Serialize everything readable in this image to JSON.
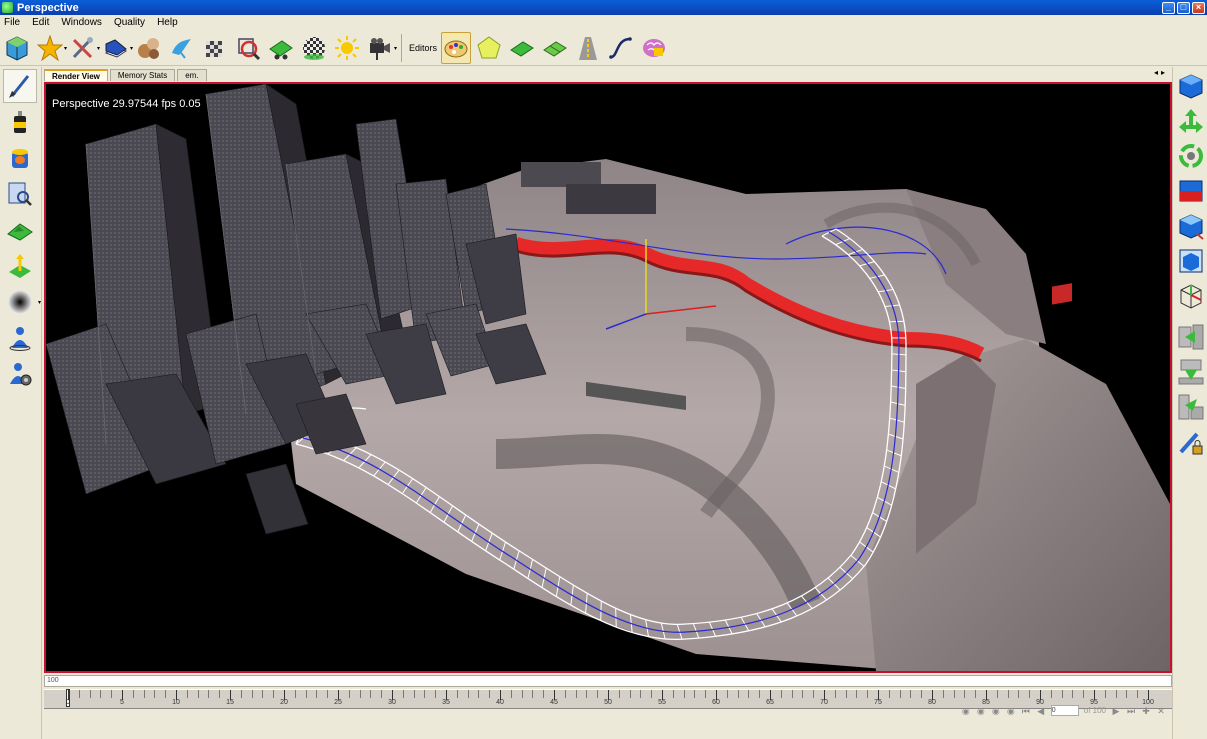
{
  "window": {
    "title": "Perspective"
  },
  "menu": [
    "File",
    "Edit",
    "Windows",
    "Quality",
    "Help"
  ],
  "toolbar": {
    "editors_label": "Editors"
  },
  "tabs": [
    {
      "label": "Render View",
      "active": true
    },
    {
      "label": "Memory Stats",
      "active": false
    },
    {
      "label": "em.",
      "active": false
    }
  ],
  "viewport": {
    "overlay_text": "Perspective 29.97544 fps 0.05"
  },
  "timeline": {
    "top_value": "100",
    "current_frame": 0,
    "max_frame": 100,
    "ticks": [
      "0",
      "5",
      "10",
      "15",
      "20",
      "25",
      "30",
      "35",
      "40",
      "45",
      "50",
      "55",
      "60",
      "65",
      "70",
      "75",
      "80",
      "85",
      "90",
      "95",
      "100"
    ],
    "of_label": "of 100"
  },
  "colors": {
    "selection_border": "#c8102e",
    "river": "#e62828",
    "terrain": "#b8aaa8"
  }
}
